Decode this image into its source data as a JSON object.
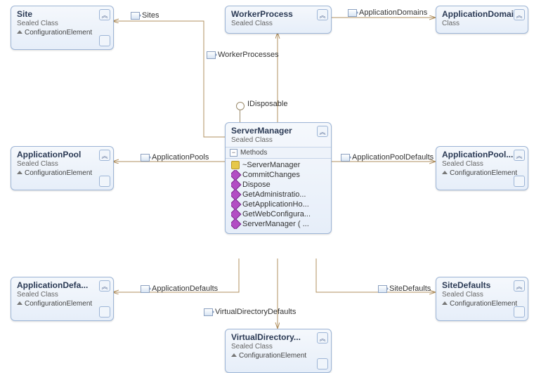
{
  "interface": {
    "name": "IDisposable"
  },
  "classes": {
    "site": {
      "name": "Site",
      "stereotype": "Sealed Class",
      "base": "ConfigurationElement"
    },
    "workerProcess": {
      "name": "WorkerProcess",
      "stereotype": "Sealed Class"
    },
    "applicationDomain": {
      "name": "ApplicationDomain",
      "stereotype": "Class"
    },
    "serverManager": {
      "name": "ServerManager",
      "stereotype": "Sealed Class",
      "sectionLabel": "Methods",
      "methods": [
        {
          "name": "~ServerManager",
          "kind": "key"
        },
        {
          "name": "CommitChanges",
          "kind": "pub"
        },
        {
          "name": "Dispose",
          "kind": "pub"
        },
        {
          "name": "GetAdministratio...",
          "kind": "pub"
        },
        {
          "name": "GetApplicationHo...",
          "kind": "pub"
        },
        {
          "name": "GetWebConfigura...",
          "kind": "pub"
        },
        {
          "name": "ServerManager ( ...",
          "kind": "pub"
        }
      ]
    },
    "applicationPool": {
      "name": "ApplicationPool",
      "stereotype": "Sealed Class",
      "base": "ConfigurationElement"
    },
    "applicationPoolDef": {
      "name": "ApplicationPool...",
      "stereotype": "Sealed Class",
      "base": "ConfigurationElement"
    },
    "applicationDefa": {
      "name": "ApplicationDefa...",
      "stereotype": "Sealed Class",
      "base": "ConfigurationElement"
    },
    "siteDefaults": {
      "name": "SiteDefaults",
      "stereotype": "Sealed Class",
      "base": "ConfigurationElement"
    },
    "virtualDirectory": {
      "name": "VirtualDirectory...",
      "stereotype": "Sealed Class",
      "base": "ConfigurationElement"
    }
  },
  "connections": {
    "sites": "Sites",
    "workerProcesses": "WorkerProcesses",
    "applicationDomains": "ApplicationDomains",
    "applicationPools": "ApplicationPools",
    "applicationPoolDefaults": "ApplicationPoolDefaults",
    "applicationDefaults": "ApplicationDefaults",
    "siteDefaults": "SiteDefaults",
    "virtualDirectoryDefaults": "VirtualDirectoryDefaults"
  },
  "chevrons": {
    "collapse": "︽",
    "expand": "︾"
  },
  "chart_data": {
    "type": "class-diagram",
    "nodes": [
      {
        "id": "ServerManager",
        "kind": "SealedClass",
        "implements": [
          "IDisposable"
        ],
        "methods": [
          "~ServerManager",
          "CommitChanges",
          "Dispose",
          "GetAdministratio...",
          "GetApplicationHo...",
          "GetWebConfigura...",
          "ServerManager ( ..."
        ]
      },
      {
        "id": "Site",
        "kind": "SealedClass",
        "base": "ConfigurationElement"
      },
      {
        "id": "WorkerProcess",
        "kind": "SealedClass"
      },
      {
        "id": "ApplicationDomain",
        "kind": "Class"
      },
      {
        "id": "ApplicationPool",
        "kind": "SealedClass",
        "base": "ConfigurationElement"
      },
      {
        "id": "ApplicationPoolDefaults",
        "label": "ApplicationPool...",
        "kind": "SealedClass",
        "base": "ConfigurationElement"
      },
      {
        "id": "ApplicationDefaults",
        "label": "ApplicationDefa...",
        "kind": "SealedClass",
        "base": "ConfigurationElement"
      },
      {
        "id": "SiteDefaults",
        "kind": "SealedClass",
        "base": "ConfigurationElement"
      },
      {
        "id": "VirtualDirectoryDefaults",
        "label": "VirtualDirectory...",
        "kind": "SealedClass",
        "base": "ConfigurationElement"
      }
    ],
    "edges": [
      {
        "from": "ServerManager",
        "to": "Site",
        "label": "Sites"
      },
      {
        "from": "ServerManager",
        "to": "WorkerProcess",
        "label": "WorkerProcesses"
      },
      {
        "from": "WorkerProcess",
        "to": "ApplicationDomain",
        "label": "ApplicationDomains"
      },
      {
        "from": "ServerManager",
        "to": "ApplicationPool",
        "label": "ApplicationPools"
      },
      {
        "from": "ServerManager",
        "to": "ApplicationPoolDefaults",
        "label": "ApplicationPoolDefaults"
      },
      {
        "from": "ServerManager",
        "to": "ApplicationDefaults",
        "label": "ApplicationDefaults"
      },
      {
        "from": "ServerManager",
        "to": "SiteDefaults",
        "label": "SiteDefaults"
      },
      {
        "from": "ServerManager",
        "to": "VirtualDirectoryDefaults",
        "label": "VirtualDirectoryDefaults"
      }
    ]
  }
}
